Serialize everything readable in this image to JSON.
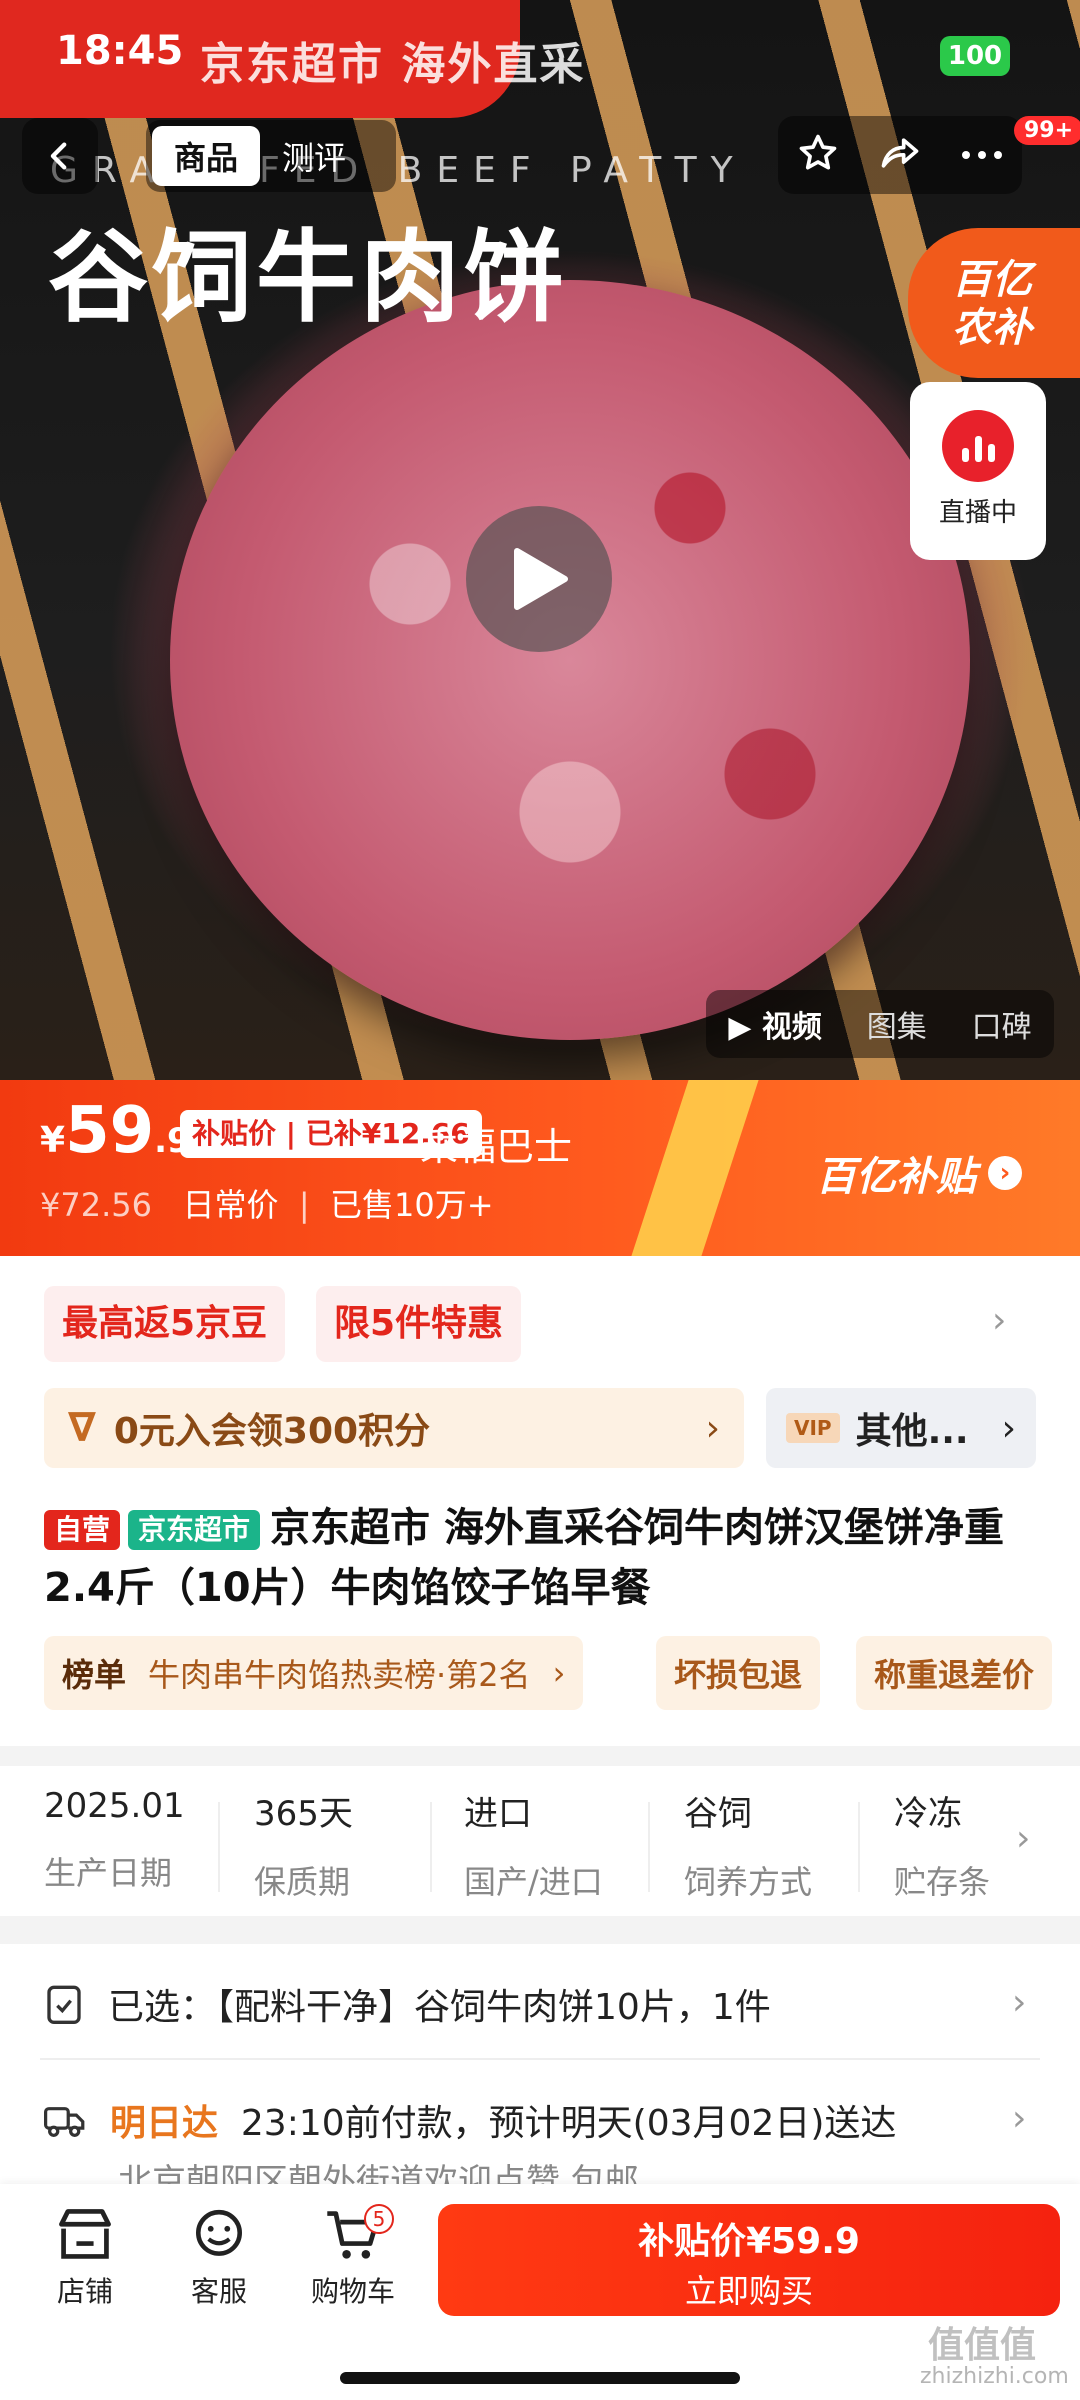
{
  "status": {
    "time": "18:45",
    "banner": "京东超市 海外直采",
    "battery": "100"
  },
  "nav": {
    "tabs": [
      "商品",
      "测评"
    ],
    "badge": "99+"
  },
  "hero": {
    "english": "GRAIN FED BEEF PATTY",
    "title": "谷饲牛肉饼",
    "promo_tag_line1": "百亿",
    "promo_tag_line2": "农补",
    "live": "直播中",
    "media_tabs": [
      "视频",
      "图集",
      "口碑"
    ]
  },
  "price": {
    "currency": "¥",
    "int": "59",
    "dec": ".9",
    "subsidy_pill": "补贴价 | 已补¥12.66",
    "overlay": "乘福巴士",
    "original": "¥72.56",
    "original_label": "日常价",
    "sold": "已售10万+",
    "brand": "百亿补贴"
  },
  "benefits": {
    "chip1": "最高返5京豆",
    "chip2": "限5件特惠",
    "member": "0元入会领300积分",
    "vip": "VIP",
    "other": "其他..."
  },
  "product": {
    "tag_self": "自营",
    "tag_store": "京东超市",
    "title": "京东超市 海外直采谷饲牛肉饼汉堡饼净重2.4斤（10片）牛肉馅饺子馅早餐",
    "rank_label": "榜单",
    "rank_text": "牛肉串牛肉馅热卖榜·第2名",
    "feat1": "坏损包退",
    "feat2": "称重退差价"
  },
  "specs": [
    {
      "value": "2025.01",
      "key": "生产日期"
    },
    {
      "value": "365天",
      "key": "保质期"
    },
    {
      "value": "进口",
      "key": "国产/进口"
    },
    {
      "value": "谷饲",
      "key": "饲养方式"
    },
    {
      "value": "冷冻",
      "key": "贮存条"
    }
  ],
  "selected": {
    "label": "已选：",
    "value": "【配料干净】谷饲牛肉饼10片，1件"
  },
  "shipping": {
    "label": "明日达",
    "text": "23:10前付款，预计明天(03月02日)送达",
    "address": "北京朝阳区朝外街道欢迎点赞  包邮"
  },
  "bottom": {
    "store": "店铺",
    "service": "客服",
    "cart": "购物车",
    "cart_count": "5",
    "buy_line1": "补贴价¥59.9",
    "buy_line2": "立即购买"
  },
  "watermark": {
    "logo": "值值值",
    "url": "zhizhizhi.com"
  }
}
